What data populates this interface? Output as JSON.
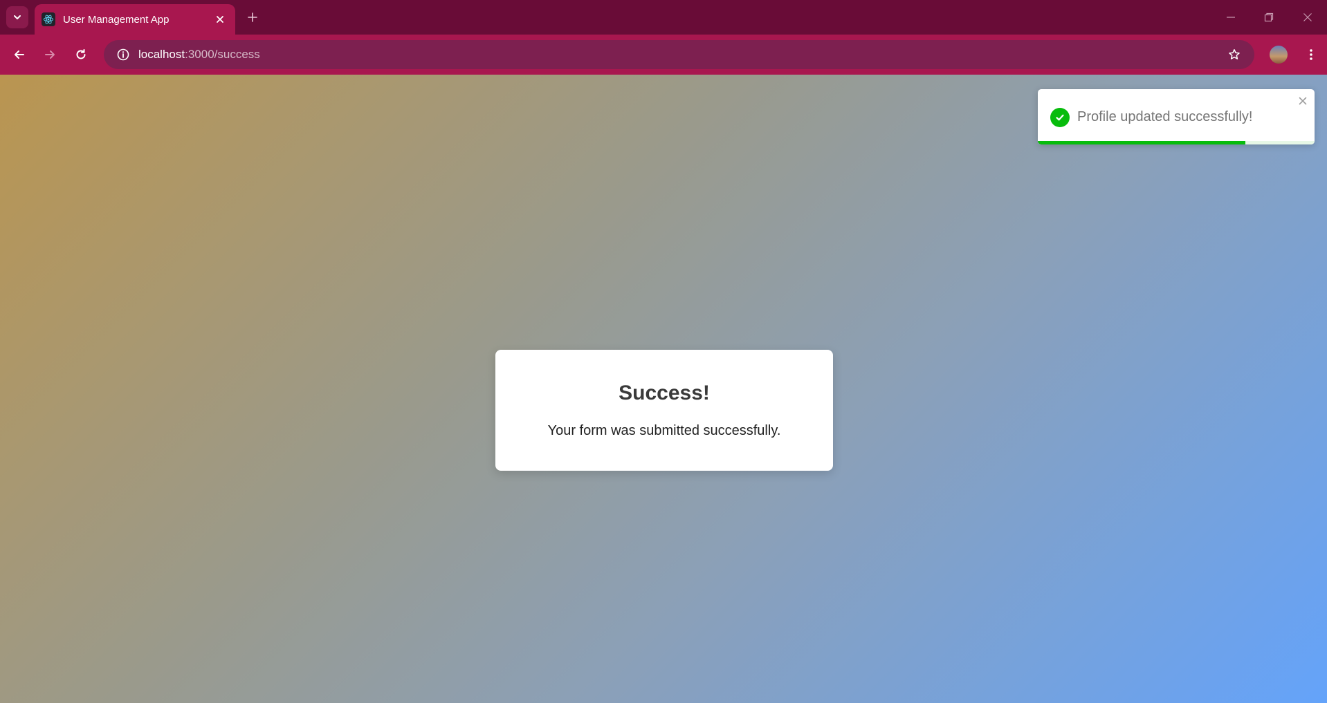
{
  "browser": {
    "tab": {
      "title": "User Management App",
      "favicon": "react-icon"
    },
    "address": {
      "host": "localhost",
      "path": ":3000/success"
    },
    "colors": {
      "frame": "#690c37",
      "toolbar": "#a8174f",
      "omnibox": "#7d2050"
    }
  },
  "page": {
    "card": {
      "title": "Success!",
      "message": "Your form was submitted successfully."
    },
    "toast": {
      "message": "Profile updated successfully!",
      "type": "success",
      "progress_remaining": 0.75,
      "accent_color": "#07bc0c"
    },
    "background_gradient": [
      "#ba9550",
      "#64a3fa"
    ]
  }
}
